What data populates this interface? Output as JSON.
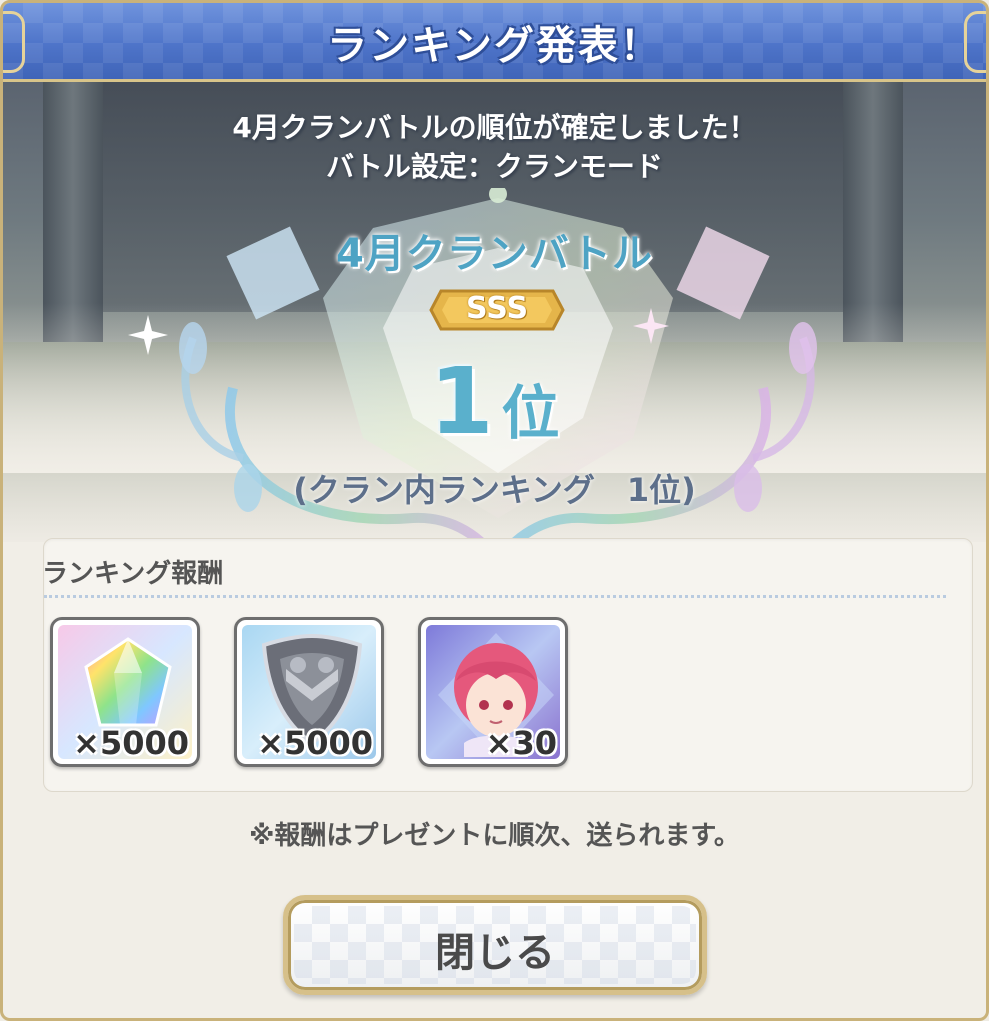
{
  "dialog": {
    "title": "ランキング発表！",
    "message_line1": "4月クランバトルの順位が確定しました！",
    "message_line2": "バトル設定：クランモード"
  },
  "result": {
    "event_name": "4月クランバトル",
    "grade": "SSS",
    "rank_number": "1",
    "rank_unit": "位",
    "clan_internal_rank": "(クラン内ランキング　1位)"
  },
  "rewards": {
    "heading": "ランキング報酬",
    "items": [
      {
        "icon": "rainbow-crystal-icon",
        "quantity": "×5000"
      },
      {
        "icon": "clan-coin-icon",
        "quantity": "×5000"
      },
      {
        "icon": "character-memory-piece-icon",
        "quantity": "×30"
      }
    ]
  },
  "footer": {
    "note": "※報酬はプレゼントに順次、送られます。",
    "close_label": "閉じる"
  },
  "colors": {
    "title_bar": "#4e74c9",
    "frame_gold": "#c9b27a",
    "rank_teal": "#5ab0cc",
    "grade_gold": "#e5b54a"
  }
}
